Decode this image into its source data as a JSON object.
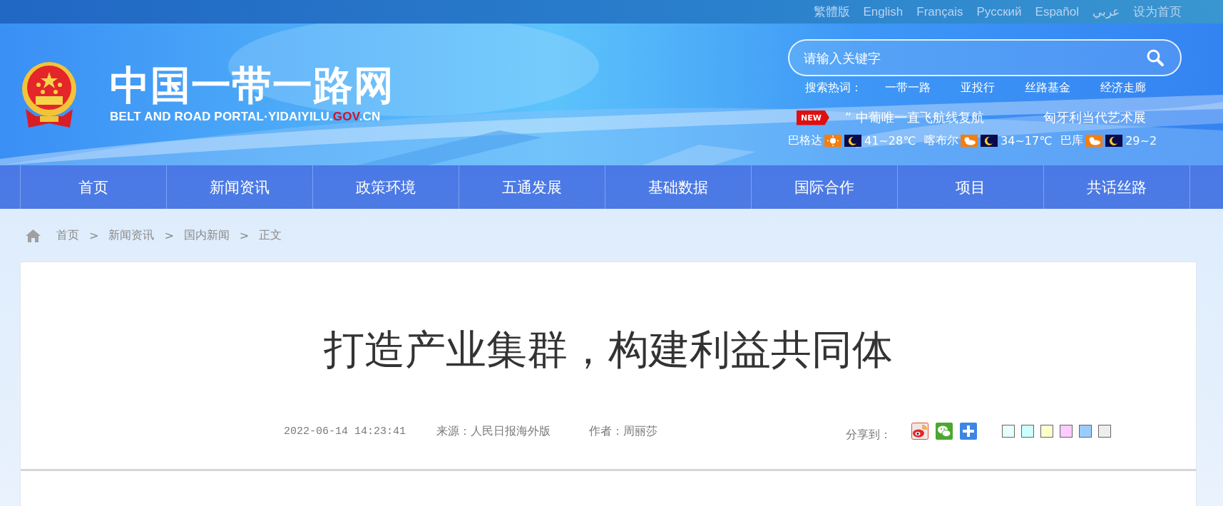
{
  "top_links": [
    "繁體版",
    "English",
    "Français",
    "Русский",
    "Español",
    "عربي",
    "设为首页"
  ],
  "logo": {
    "title": "中国一带一路网",
    "subtitle_parts": [
      {
        "text": "BELT AND ROAD PORTAL·YIDAIYILU.",
        "highlight": false
      },
      {
        "text": "GOV",
        "highlight": true
      },
      {
        "text": ".CN",
        "highlight": false
      }
    ]
  },
  "search": {
    "placeholder": "请输入关键字"
  },
  "hot_words": {
    "label": "搜索热词：",
    "items": [
      "一带一路",
      "亚投行",
      "丝路基金",
      "经济走廊"
    ]
  },
  "ticker": {
    "badge": "NEW",
    "items": [
      "” 中葡唯一直飞航线复航",
      "匈牙利当代艺术展"
    ]
  },
  "weather": [
    {
      "city": "巴格达",
      "kind": "sunny",
      "temp": "41~28℃"
    },
    {
      "city": "喀布尔",
      "kind": "partly-cloudy",
      "temp": "34~17℃"
    },
    {
      "city": "巴库",
      "kind": "partly-cloudy",
      "temp": "29~2"
    }
  ],
  "nav": [
    "首页",
    "新闻资讯",
    "政策环境",
    "五通发展",
    "基础数据",
    "国际合作",
    "项目",
    "共话丝路"
  ],
  "breadcrumb": [
    {
      "kind": "link",
      "text": "首页"
    },
    {
      "kind": "separator",
      "text": ">"
    },
    {
      "kind": "link",
      "text": "新闻资讯"
    },
    {
      "kind": "separator",
      "text": ">"
    },
    {
      "kind": "link",
      "text": "国内新闻"
    },
    {
      "kind": "separator",
      "text": ">"
    },
    {
      "kind": "link",
      "text": "正文"
    }
  ],
  "article": {
    "title": "打造产业集群，构建利益共同体",
    "date": "2022-06-14 14:23:41",
    "source": "来源：人民日报海外版",
    "author": "作者：周丽莎",
    "share": {
      "label": "分享到：",
      "targets": [
        {
          "kind": "weibo"
        },
        {
          "kind": "wechat"
        },
        {
          "kind": "more"
        }
      ]
    },
    "background_swatches": [
      {
        "color": "#e8ffff"
      },
      {
        "color": "#ccffff"
      },
      {
        "color": "#ffffcc"
      },
      {
        "color": "#ffccff"
      },
      {
        "color": "#99ccff"
      },
      {
        "color": "#eeeeee"
      }
    ]
  }
}
